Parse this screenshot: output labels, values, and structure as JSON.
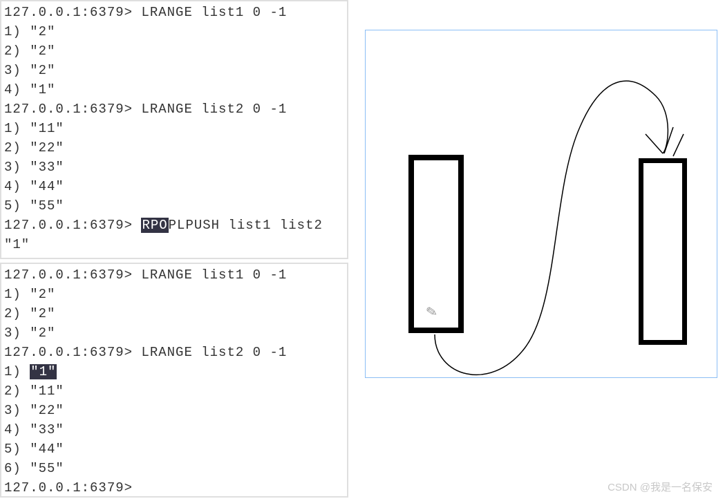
{
  "prompt": "127.0.0.1:6379>",
  "block1": {
    "cmd1": "LRANGE list1 0 -1",
    "list1_results": [
      {
        "idx": "1)",
        "val": "\"2\""
      },
      {
        "idx": "2)",
        "val": "\"2\""
      },
      {
        "idx": "3)",
        "val": "\"2\""
      },
      {
        "idx": "4)",
        "val": "\"1\""
      }
    ],
    "cmd2": "LRANGE list2 0 -1",
    "list2_results": [
      {
        "idx": "1)",
        "val": "\"11\""
      },
      {
        "idx": "2)",
        "val": "\"22\""
      },
      {
        "idx": "3)",
        "val": "\"33\""
      },
      {
        "idx": "4)",
        "val": "\"44\""
      },
      {
        "idx": "5)",
        "val": "\"55\""
      }
    ],
    "cmd3_hl": "RPO",
    "cmd3_rest": "PLPUSH list1 list2",
    "cmd3_result": "\"1\""
  },
  "block2": {
    "cmd1": "LRANGE list1 0 -1",
    "list1_results": [
      {
        "idx": "1)",
        "val": "\"2\""
      },
      {
        "idx": "2)",
        "val": "\"2\""
      },
      {
        "idx": "3)",
        "val": "\"2\""
      }
    ],
    "cmd2": "LRANGE list2 0 -1",
    "list2_results": [
      {
        "idx": "1)",
        "val": "\"1\"",
        "hl": true
      },
      {
        "idx": "2)",
        "val": "\"11\""
      },
      {
        "idx": "3)",
        "val": "\"22\""
      },
      {
        "idx": "4)",
        "val": "\"33\""
      },
      {
        "idx": "5)",
        "val": "\"44\""
      },
      {
        "idx": "6)",
        "val": "\"55\""
      }
    ]
  },
  "watermark": "CSDN @我是一名保安"
}
